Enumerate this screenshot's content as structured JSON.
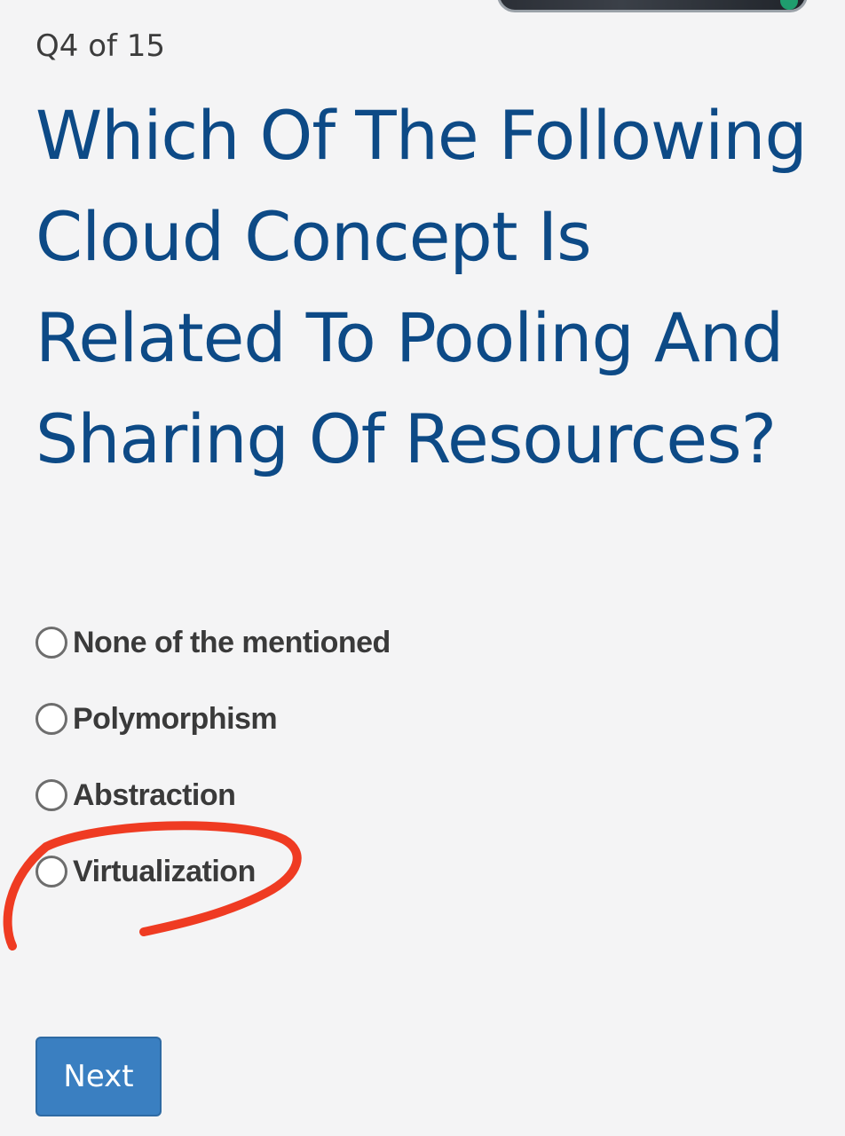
{
  "quiz": {
    "counter": "Q4 of 15",
    "question": "Which Of The Following Cloud Concept Is Related To Pooling And Sharing Of Resources?",
    "options": [
      {
        "label": "None of the mentioned",
        "selected": false
      },
      {
        "label": "Polymorphism",
        "selected": false
      },
      {
        "label": "Abstraction",
        "selected": false
      },
      {
        "label": "Virtualization",
        "selected": false,
        "annotated": true
      }
    ],
    "next_label": "Next"
  },
  "colors": {
    "question": "#0d4a86",
    "button": "#3a7fc1",
    "annotation": "#ef3b22",
    "background": "#f4f4f5"
  },
  "icons": {
    "option_marker": "radio-circle-icon",
    "annotation_mark": "hand-drawn-red-circle"
  }
}
